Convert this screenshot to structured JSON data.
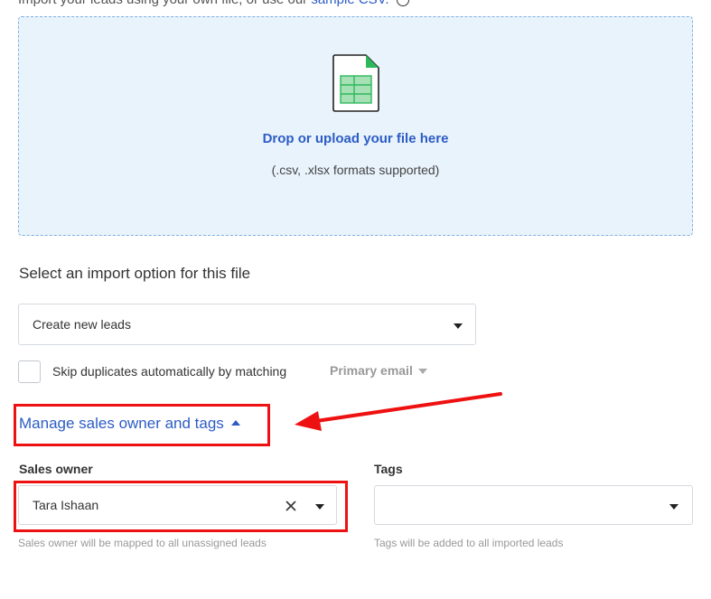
{
  "header": {
    "intro_text": "Import your leads using your own file, or use our",
    "sample_link": "sample CSV."
  },
  "upload": {
    "title": "Drop or upload your file here",
    "formats": "(.csv, .xlsx formats supported)"
  },
  "import_option": {
    "label": "Select an import option for this file",
    "selected": "Create new leads"
  },
  "duplicates": {
    "label": "Skip duplicates automatically by matching",
    "match_field": "Primary email",
    "checked": false
  },
  "manage": {
    "link_text": "Manage sales owner and tags"
  },
  "sales_owner": {
    "label": "Sales owner",
    "value": "Tara Ishaan",
    "hint": "Sales owner will be mapped to all unassigned leads"
  },
  "tags": {
    "label": "Tags",
    "value": "",
    "hint": "Tags will be added to all imported leads"
  },
  "colors": {
    "accent": "#2c5cc5",
    "annotation": "#ee1111",
    "dropzone_bg": "#e9f3fc"
  }
}
